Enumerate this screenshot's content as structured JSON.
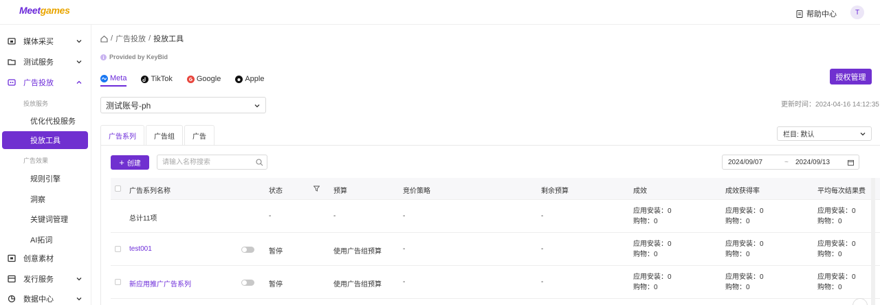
{
  "brand": {
    "logo_a": "Meet",
    "logo_b": "games"
  },
  "header": {
    "help_label": "帮助中心",
    "avatar_initial": "T"
  },
  "sidebar": {
    "items": [
      {
        "label": "媒体采买"
      },
      {
        "label": "测试服务"
      },
      {
        "label": "广告投放"
      },
      {
        "label": "创意素材"
      },
      {
        "label": "发行服务"
      },
      {
        "label": "数据中心"
      }
    ],
    "group_delivery": "投放服务",
    "sub_optimize": "优化代投服务",
    "sub_tool": "投放工具",
    "group_effect": "广告效果",
    "sub_rules": "规则引擎",
    "sub_insight": "洞察",
    "sub_keywords": "关键词管理",
    "sub_ai": "AI拓词"
  },
  "breadcrumb": {
    "level1": "广告投放",
    "level2": "投放工具"
  },
  "provided_by": "Provided by KeyBid",
  "platform_tabs": [
    "Meta",
    "TikTok",
    "Google",
    "Apple"
  ],
  "auth_button": "授权管理",
  "account_select": "测试账号-ph",
  "update_time": "更新时间：2024-04-16 14:12:35",
  "level_tabs": [
    "广告系列",
    "广告组",
    "广告"
  ],
  "column_select": "栏目: 默认",
  "toolbar": {
    "create_label": "创建",
    "search_placeholder": "请输入名称搜索",
    "date_start": "2024/09/07",
    "date_sep": "~",
    "date_end": "2024/09/13"
  },
  "table": {
    "headers": [
      "广告系列名称",
      "状态",
      "预算",
      "竞价策略",
      "剩余预算",
      "成效",
      "成效获得率",
      "平均每次结果费"
    ],
    "summary": {
      "name": "总计11项",
      "status": "-",
      "budget": "-",
      "bid": "-",
      "remaining": "-"
    },
    "rows": [
      {
        "name": "test001",
        "status": "暂停",
        "budget": "使用广告组预算",
        "bid": "-",
        "remaining": "-"
      },
      {
        "name": "新应用推广广告系列",
        "status": "暂停",
        "budget": "使用广告组预算",
        "bid": "-",
        "remaining": "-"
      }
    ],
    "metric_line1": "应用安装：0",
    "metric_line2": "购物：0"
  },
  "colors": {
    "accent": "#7030d0"
  }
}
